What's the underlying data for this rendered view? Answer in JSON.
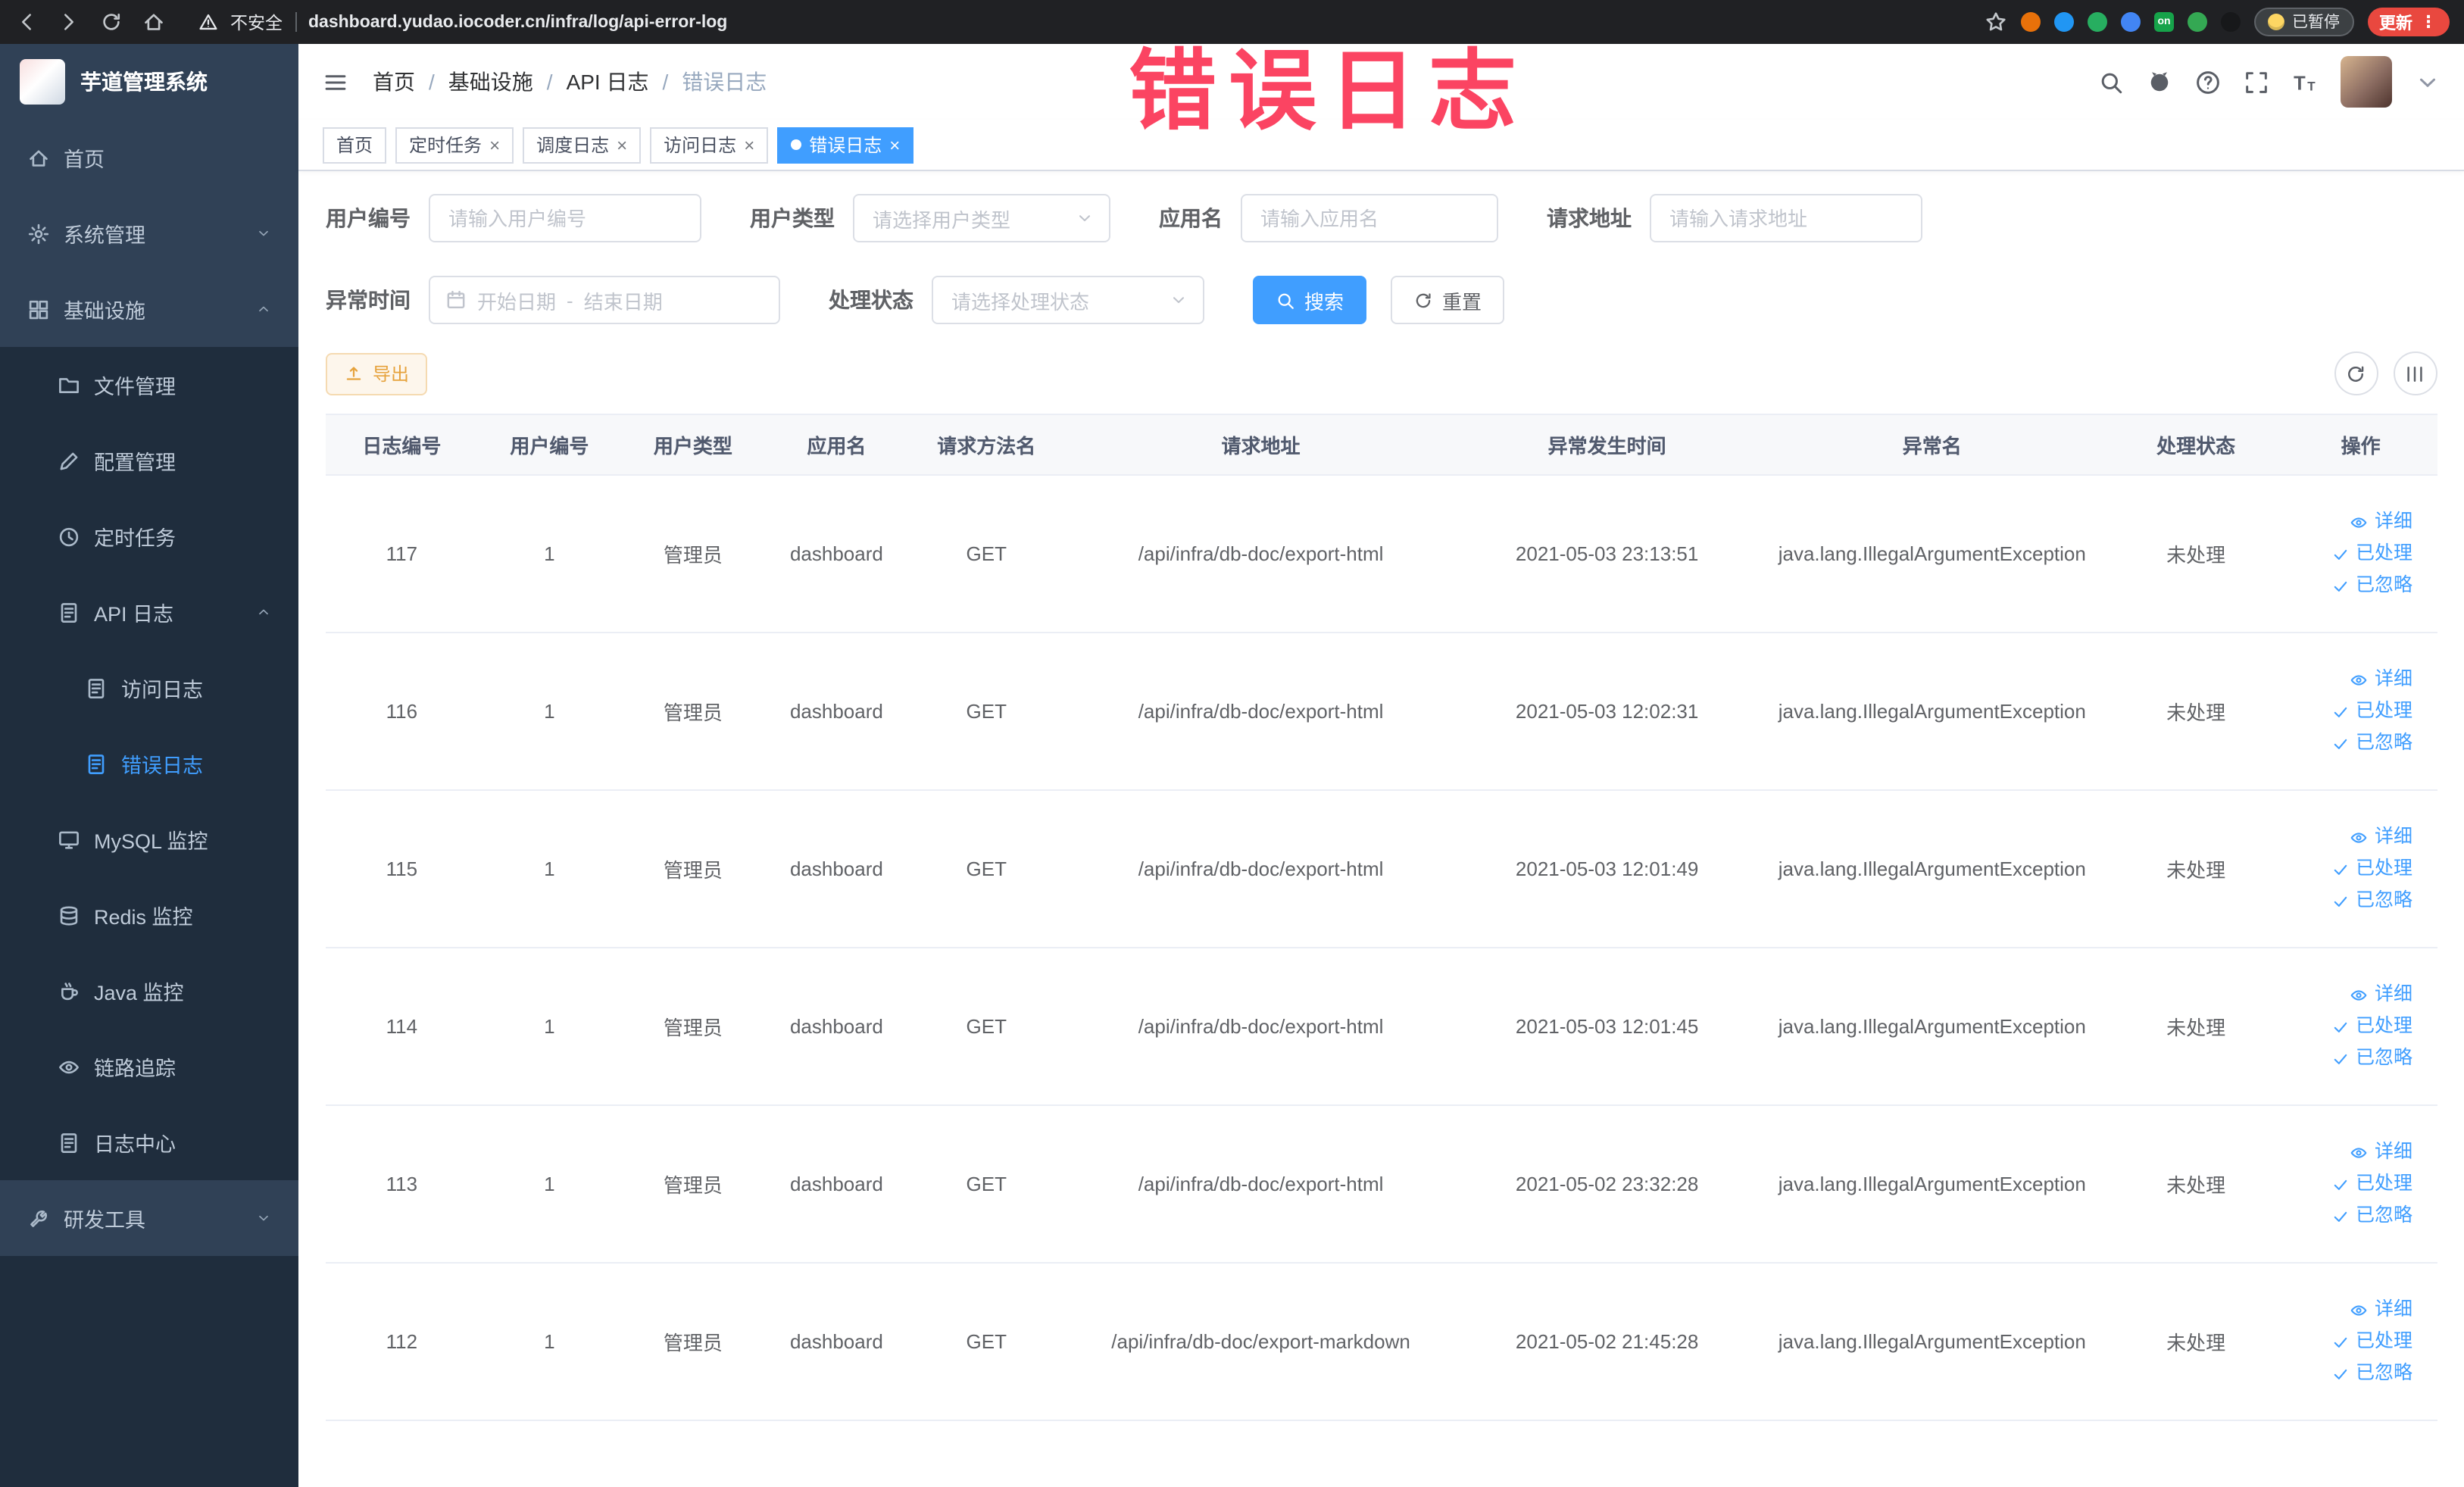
{
  "colors": {
    "accent": "#409eff",
    "sidebar_bg": "#304156",
    "sidebar_sub_bg": "#1f2d3d",
    "watermark": "#fb3a5a",
    "warning": "#e6a23c",
    "active_tab_bg": "#409eff"
  },
  "watermark": "错误日志",
  "browser": {
    "security_label": "不安全",
    "url": "dashboard.yudao.iocoder.cn/infra/log/api-error-log",
    "paused_badge": "已暂停",
    "update_button": "更新",
    "nav_icons": [
      {
        "icon": "back",
        "name": "back-icon"
      },
      {
        "icon": "forward",
        "name": "forward-icon"
      },
      {
        "icon": "reload",
        "name": "reload-icon"
      },
      {
        "icon": "home",
        "name": "home-icon"
      }
    ],
    "extensions": [
      {
        "name": "extension-orange",
        "color": "#e8710a"
      },
      {
        "name": "extension-blue-drop",
        "color": "#2196f3"
      },
      {
        "name": "extension-green-circle",
        "color": "#27ae60"
      },
      {
        "name": "extension-blue-grid",
        "color": "#4285f4"
      },
      {
        "name": "extension-on-badge",
        "color": "#16a34a",
        "label": "on"
      },
      {
        "name": "extension-green-leaf",
        "color": "#34a853"
      },
      {
        "name": "extension-dark",
        "color": "#17181a"
      }
    ]
  },
  "sidebar": {
    "app_title": "芋道管理系统",
    "items": [
      {
        "key": "home",
        "label": "首页",
        "icon": "home",
        "level": 0
      },
      {
        "key": "system",
        "label": "系统管理",
        "icon": "settings",
        "level": 0,
        "arrow": "down"
      },
      {
        "key": "infrastructure",
        "label": "基础设施",
        "icon": "infrastructure",
        "level": 0,
        "arrow": "up"
      },
      {
        "key": "file",
        "label": "文件管理",
        "icon": "file",
        "level": 1
      },
      {
        "key": "config",
        "label": "配置管理",
        "icon": "config",
        "level": 1
      },
      {
        "key": "job",
        "label": "定时任务",
        "icon": "schedule",
        "level": 1
      },
      {
        "key": "api-log",
        "label": "API 日志",
        "icon": "api-log",
        "level": 1,
        "arrow": "up"
      },
      {
        "key": "access-log",
        "label": "访问日志",
        "icon": "access-log",
        "level": 2
      },
      {
        "key": "error-log",
        "label": "错误日志",
        "icon": "error-log",
        "level": 2,
        "active": true
      },
      {
        "key": "mysql",
        "label": "MySQL 监控",
        "icon": "mysql",
        "level": 1
      },
      {
        "key": "redis",
        "label": "Redis 监控",
        "icon": "redis",
        "level": 1
      },
      {
        "key": "java",
        "label": "Java 监控",
        "icon": "java",
        "level": 1
      },
      {
        "key": "trace",
        "label": "链路追踪",
        "icon": "trace",
        "level": 1
      },
      {
        "key": "log-center",
        "label": "日志中心",
        "icon": "log-center",
        "level": 1
      },
      {
        "key": "dev-tools",
        "label": "研发工具",
        "icon": "tools",
        "level": 0,
        "arrow": "down"
      }
    ]
  },
  "breadcrumb": [
    "首页",
    "基础设施",
    "API 日志",
    "错误日志"
  ],
  "navbar": {
    "icons": [
      {
        "icon": "search",
        "name": "search-icon"
      },
      {
        "icon": "github",
        "name": "github-icon"
      },
      {
        "icon": "question",
        "name": "help-icon"
      },
      {
        "icon": "fullscreen",
        "name": "fullscreen-icon"
      },
      {
        "icon": "fontsize",
        "name": "font-size-icon"
      }
    ]
  },
  "tabs": [
    {
      "key": "home",
      "label": "首页",
      "closable": false,
      "active": false
    },
    {
      "key": "scheduled-job",
      "label": "定时任务",
      "closable": true,
      "active": false
    },
    {
      "key": "job-log",
      "label": "调度日志",
      "closable": true,
      "active": false
    },
    {
      "key": "access-log",
      "label": "访问日志",
      "closable": true,
      "active": false
    },
    {
      "key": "error-log",
      "label": "错误日志",
      "closable": true,
      "active": true
    }
  ],
  "filters": {
    "user_id": {
      "label": "用户编号",
      "placeholder": "请输入用户编号"
    },
    "user_type": {
      "label": "用户类型",
      "placeholder": "请选择用户类型"
    },
    "app_name": {
      "label": "应用名",
      "placeholder": "请输入应用名"
    },
    "request_url": {
      "label": "请求地址",
      "placeholder": "请输入请求地址"
    },
    "exception_time": {
      "label": "异常时间",
      "start_placeholder": "开始日期",
      "separator": "-",
      "end_placeholder": "结束日期"
    },
    "process_status": {
      "label": "处理状态",
      "placeholder": "请选择处理状态"
    },
    "search_label": "搜索",
    "reset_label": "重置"
  },
  "toolbar": {
    "export_label": "导出"
  },
  "table": {
    "headers": [
      "日志编号",
      "用户编号",
      "用户类型",
      "应用名",
      "请求方法名",
      "请求地址",
      "异常发生时间",
      "异常名",
      "处理状态",
      "操作"
    ],
    "rows": [
      {
        "id": "117",
        "user_id": "1",
        "user_type": "管理员",
        "app": "dashboard",
        "method": "GET",
        "url": "/api/infra/db-doc/export-html",
        "time": "2021-05-03 23:13:51",
        "exception": "java.lang.IllegalArgumentException",
        "status": "未处理"
      },
      {
        "id": "116",
        "user_id": "1",
        "user_type": "管理员",
        "app": "dashboard",
        "method": "GET",
        "url": "/api/infra/db-doc/export-html",
        "time": "2021-05-03 12:02:31",
        "exception": "java.lang.IllegalArgumentException",
        "status": "未处理"
      },
      {
        "id": "115",
        "user_id": "1",
        "user_type": "管理员",
        "app": "dashboard",
        "method": "GET",
        "url": "/api/infra/db-doc/export-html",
        "time": "2021-05-03 12:01:49",
        "exception": "java.lang.IllegalArgumentException",
        "status": "未处理"
      },
      {
        "id": "114",
        "user_id": "1",
        "user_type": "管理员",
        "app": "dashboard",
        "method": "GET",
        "url": "/api/infra/db-doc/export-html",
        "time": "2021-05-03 12:01:45",
        "exception": "java.lang.IllegalArgumentException",
        "status": "未处理"
      },
      {
        "id": "113",
        "user_id": "1",
        "user_type": "管理员",
        "app": "dashboard",
        "method": "GET",
        "url": "/api/infra/db-doc/export-html",
        "time": "2021-05-02 23:32:28",
        "exception": "java.lang.IllegalArgumentException",
        "status": "未处理"
      },
      {
        "id": "112",
        "user_id": "1",
        "user_type": "管理员",
        "app": "dashboard",
        "method": "GET",
        "url": "/api/infra/db-doc/export-markdown",
        "time": "2021-05-02 21:45:28",
        "exception": "java.lang.IllegalArgumentException",
        "status": "未处理"
      }
    ],
    "row_actions": [
      {
        "label": "详细",
        "icon": "eye"
      },
      {
        "label": "已处理",
        "icon": "check"
      },
      {
        "label": "已忽略",
        "icon": "check"
      }
    ]
  }
}
